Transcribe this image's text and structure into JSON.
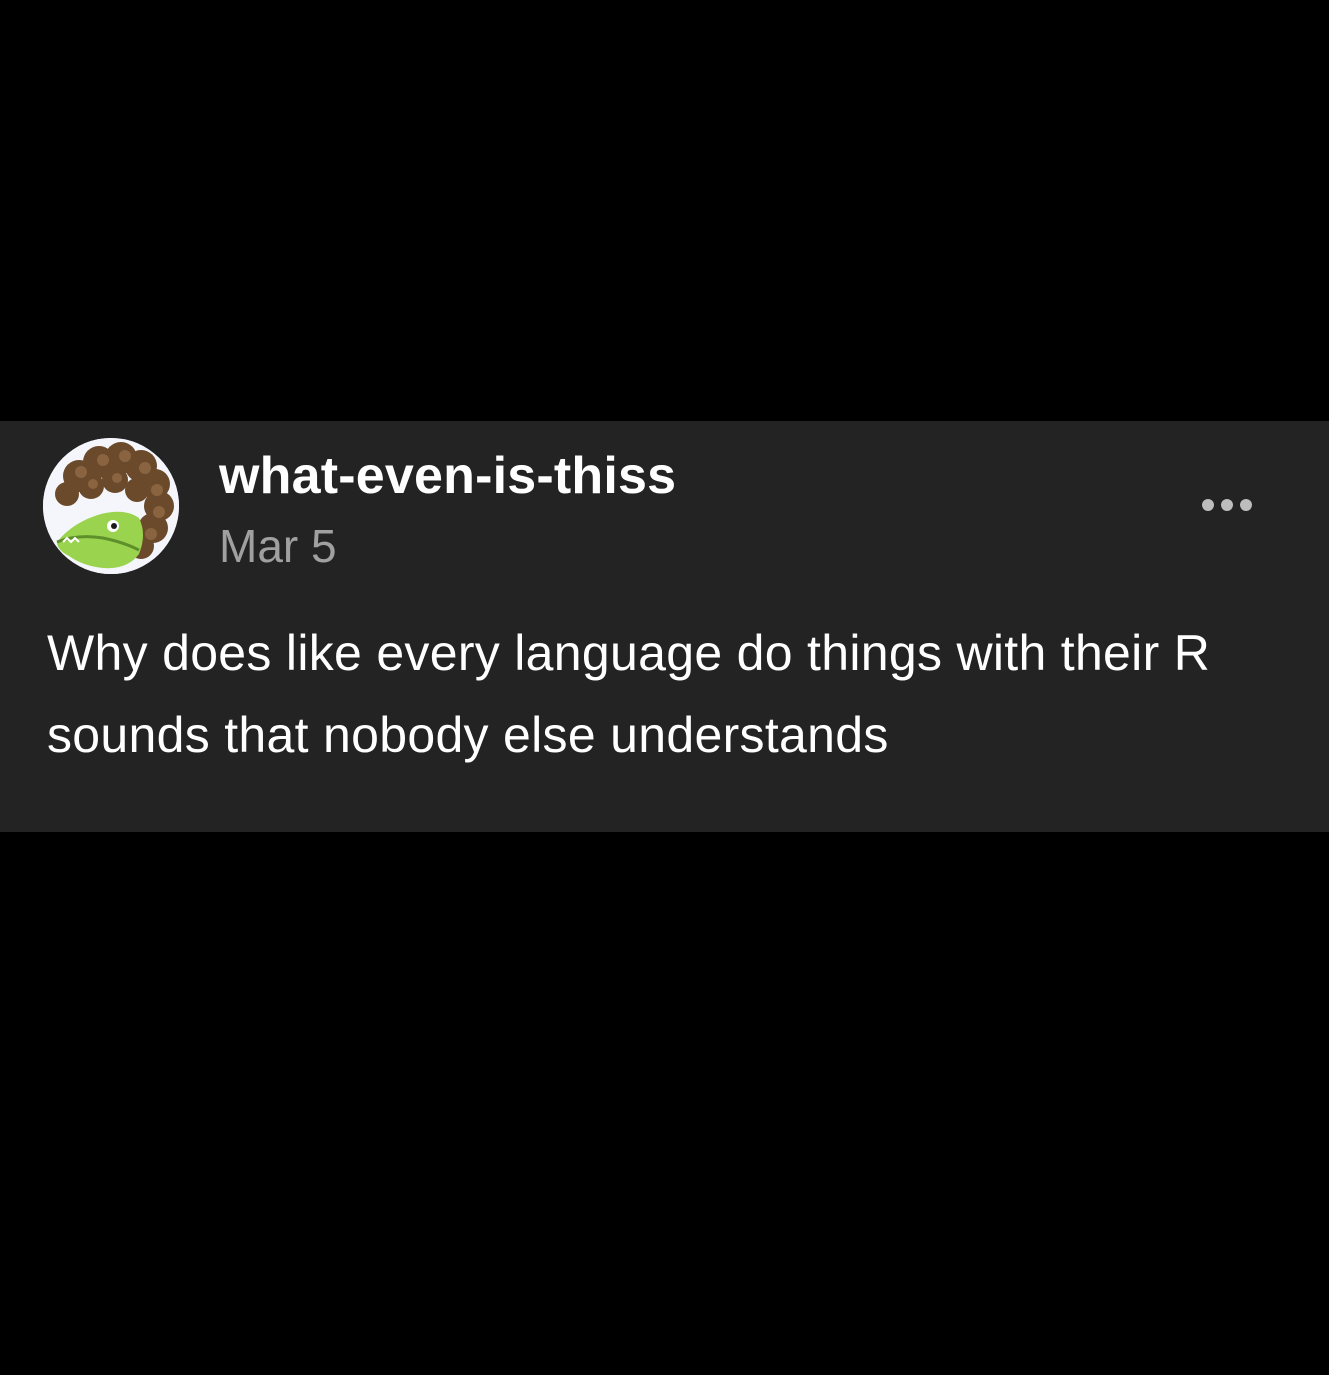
{
  "post": {
    "username": "what-even-is-thiss",
    "date": "Mar 5",
    "body": "Why does like every language do things with their R sounds that nobody else understands"
  },
  "icons": {
    "avatar": "crocodile-avatar",
    "more": "more-options-icon"
  },
  "colors": {
    "page_background": "#000000",
    "card_background": "#232323",
    "text_primary": "#ffffff",
    "text_secondary": "#a0a0a0"
  }
}
